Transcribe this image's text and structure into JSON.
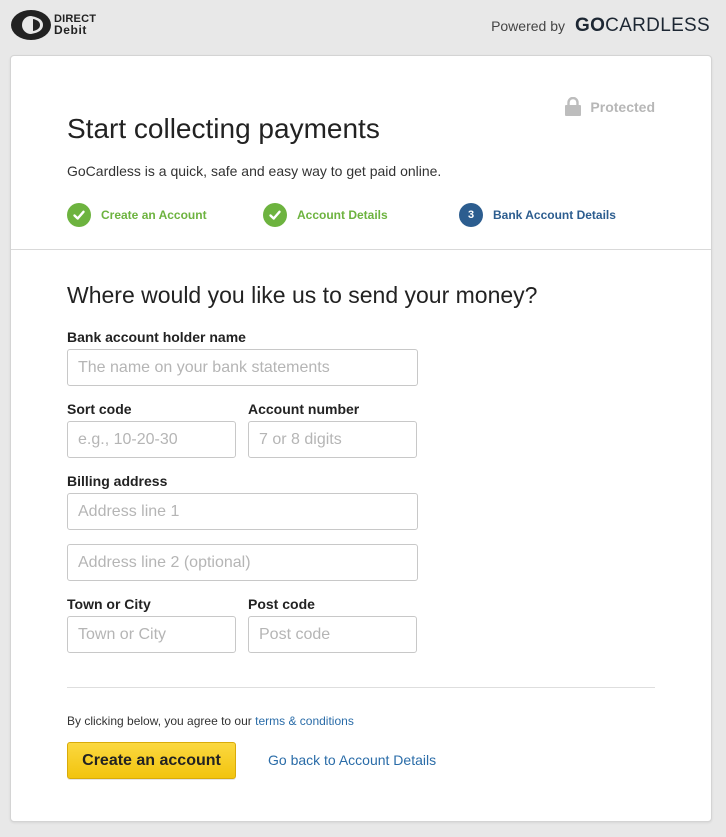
{
  "header": {
    "direct_debit_logo": {
      "line1": "DIRECT",
      "line2": "Debit"
    },
    "powered_by": "Powered by",
    "brand_bold": "GO",
    "brand_rest": "CARDLESS"
  },
  "card": {
    "protected_label": "Protected",
    "title": "Start collecting payments",
    "subtitle": "GoCardless is a quick, safe and easy way to get paid online.",
    "steps": [
      {
        "label": "Create an Account",
        "status": "complete",
        "badge": "check"
      },
      {
        "label": "Account Details",
        "status": "complete",
        "badge": "check"
      },
      {
        "label": "Bank Account Details",
        "status": "active",
        "badge": "3"
      }
    ]
  },
  "form": {
    "title": "Where would you like us to send your money?",
    "holder_name": {
      "label": "Bank account holder name",
      "placeholder": "The name on your bank statements",
      "value": ""
    },
    "sort_code": {
      "label": "Sort code",
      "placeholder": "e.g., 10-20-30",
      "value": ""
    },
    "account_number": {
      "label": "Account number",
      "placeholder": "7 or 8 digits",
      "value": ""
    },
    "billing_address": {
      "label": "Billing address",
      "line1_placeholder": "Address line 1",
      "line2_placeholder": "Address line 2 (optional)"
    },
    "town": {
      "label": "Town or City",
      "placeholder": "Town or City",
      "value": ""
    },
    "post_code": {
      "label": "Post code",
      "placeholder": "Post code",
      "value": ""
    }
  },
  "footer": {
    "agree_text": "By clicking below, you agree to our ",
    "terms_link": "terms & conditions",
    "create_button": "Create an account",
    "back_link": "Go back to Account Details"
  },
  "colors": {
    "complete_green": "#6db33f",
    "active_blue": "#2c5d8f",
    "link_blue": "#2a6ca8",
    "button_yellow": "#f5c918"
  }
}
